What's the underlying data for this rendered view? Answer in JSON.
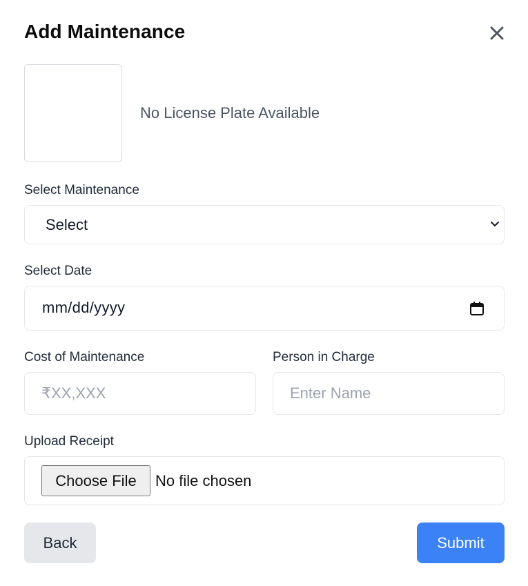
{
  "modal": {
    "title": "Add Maintenance",
    "close_icon": "close-icon"
  },
  "vehicle": {
    "plate_message": "No License Plate Available"
  },
  "form": {
    "maintenance": {
      "label": "Select Maintenance",
      "value": "Select",
      "icon": "chevron-down-icon"
    },
    "date": {
      "label": "Select Date",
      "value": "mm/dd/yyyy",
      "icon": "calendar-icon"
    },
    "cost": {
      "label": "Cost of Maintenance",
      "placeholder": "₹XX,XXX"
    },
    "person": {
      "label": "Person in Charge",
      "placeholder": "Enter Name"
    },
    "receipt": {
      "label": "Upload Receipt",
      "button_label": "Choose File",
      "status": "No file chosen"
    }
  },
  "actions": {
    "back_label": "Back",
    "submit_label": "Submit"
  },
  "colors": {
    "primary": "#3b82f6",
    "secondary": "#e5e7eb",
    "border": "#e5e7eb"
  }
}
